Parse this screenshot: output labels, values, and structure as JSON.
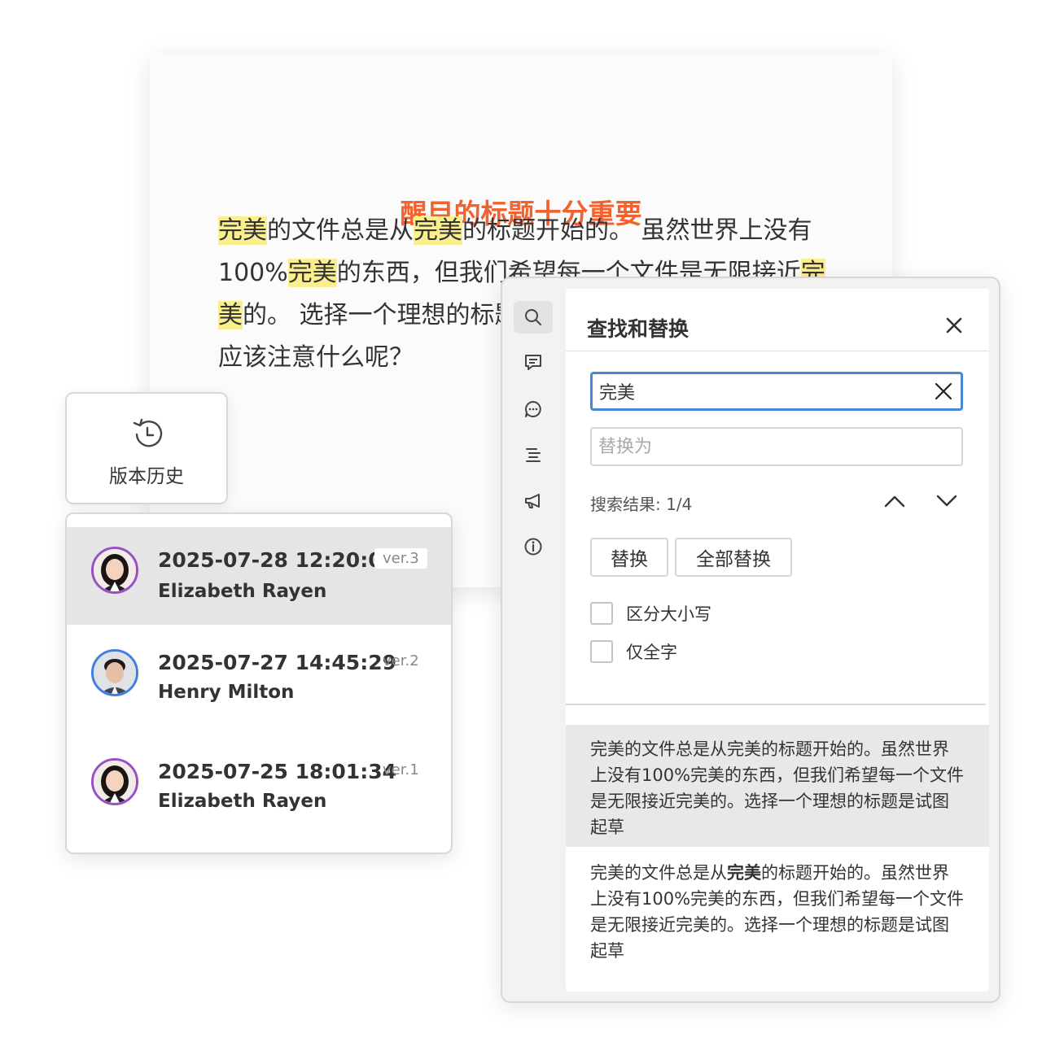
{
  "document": {
    "title": "醒目的标题十分重要",
    "paragraph": [
      {
        "text": "完美",
        "highlight": true
      },
      {
        "text": "的文件总是从",
        "highlight": false
      },
      {
        "text": "完美",
        "highlight": true
      },
      {
        "text": "的标题开始的。 虽然世界上没有100%",
        "highlight": false
      },
      {
        "text": "完美",
        "highlight": true
      },
      {
        "text": "的东西，但我们希望每一个文件是无限接近",
        "highlight": false
      },
      {
        "text": "完美",
        "highlight": true
      },
      {
        "text": "的。 选择一个理想的标题，良好、外观漂亮的文件时，应该注意什么呢？",
        "highlight": false
      }
    ]
  },
  "history_button": {
    "label": "版本历史",
    "icon": "history-icon"
  },
  "history": [
    {
      "date": "2025-07-28 12:20:01",
      "author": "Elizabeth Rayen",
      "version": "ver.3",
      "selected": true,
      "avatar_ring": "#9b4fc4"
    },
    {
      "date": "2025-07-27 14:45:29",
      "author": "Henry Milton",
      "version": "ver.2",
      "selected": false,
      "avatar_ring": "#3f7fe0"
    },
    {
      "date": "2025-07-25 18:01:34",
      "author": "Elizabeth Rayen",
      "version": "ver.1",
      "selected": false,
      "avatar_ring": "#9b4fc4"
    }
  ],
  "sidebar_icons": [
    "search-icon",
    "comment-icon",
    "chat-icon",
    "outline-icon",
    "announcement-icon",
    "info-icon"
  ],
  "find_panel": {
    "title": "查找和替换",
    "search_value": "完美",
    "replace_placeholder": "替换为",
    "result_count": "搜索结果: 1/4",
    "replace_label": "替换",
    "replace_all_label": "全部替换",
    "match_case_label": "区分大小写",
    "whole_word_label": "仅全字",
    "results": [
      {
        "before": "完美的文件总是从完美的标题开始的。虽然世界上没有100%完美的东西，但我们希望每一个文件是无限接近完美的。选择一个理想的标题是试图起草",
        "match": "",
        "after": "",
        "selected": true
      },
      {
        "before": "完美的文件总是从",
        "match": "完美",
        "after": "的标题开始的。虽然世界上没有100%完美的东西，但我们希望每一个文件是无限接近完美的。选择一个理想的标题是试图起草",
        "selected": false
      }
    ]
  },
  "colors": {
    "title": "#f2622e",
    "highlight": "#fbee8c",
    "focus_border": "#4a86d8",
    "selected_bg": "#e5e5e5"
  }
}
